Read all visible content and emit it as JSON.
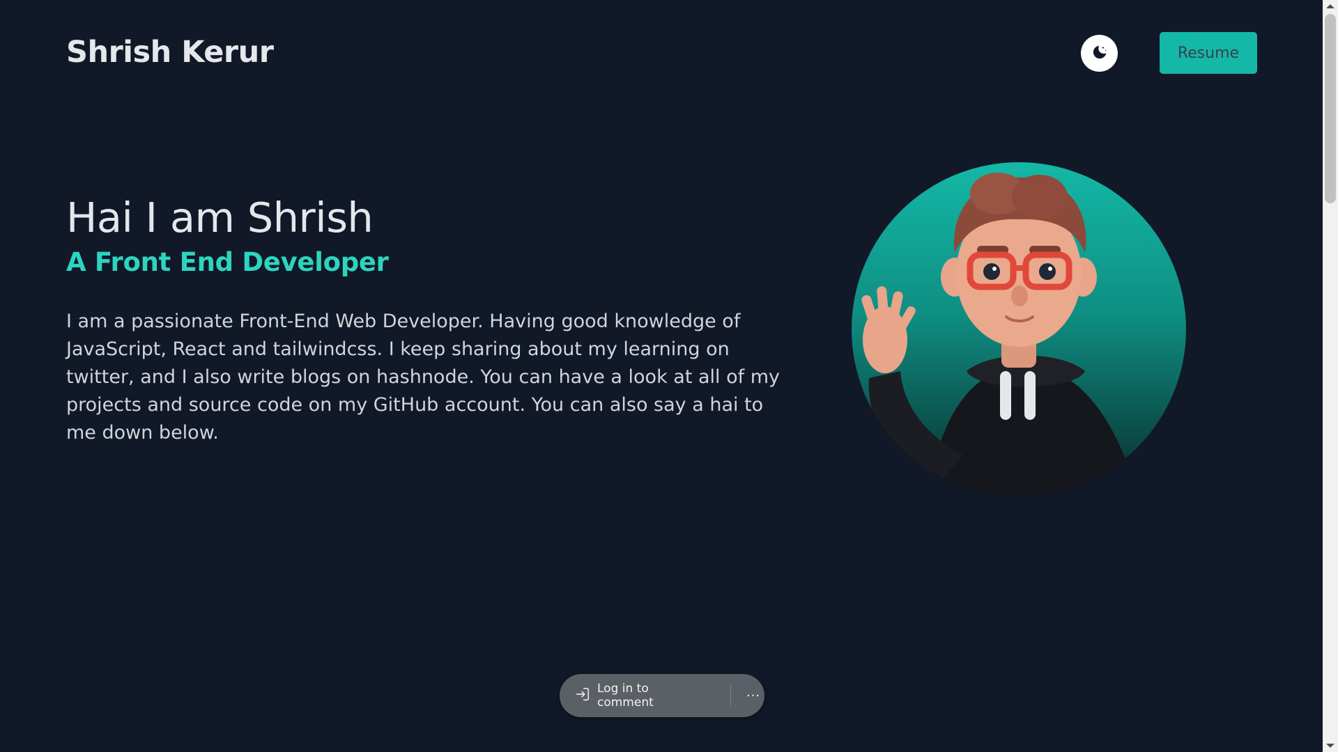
{
  "header": {
    "brand": "Shrish Kerur",
    "theme_toggle_icon": "moon-stars-icon",
    "resume_label": "Resume"
  },
  "hero": {
    "title": "Hai I am Shrish",
    "subtitle": "A Front End Developer",
    "bio": "I am a passionate Front-End Web Developer. Having good knowledge of JavaScript, React and tailwindcss. I keep sharing about my learning on twitter, and I also write blogs on hashnode. You can have a look at all of my projects and source code on my GitHub account. You can also say a hai to me down below."
  },
  "avatar": {
    "icon": "developer-avatar-illustration"
  },
  "comment_bar": {
    "login_icon": "login-arrow-icon",
    "login_label": "Log in to comment",
    "more_icon": "more-icon",
    "more_label": "···"
  },
  "colors": {
    "background": "#111827",
    "accent": "#14b8a6",
    "accent_text": "#2dd4bf",
    "text": "#e5e7eb"
  }
}
